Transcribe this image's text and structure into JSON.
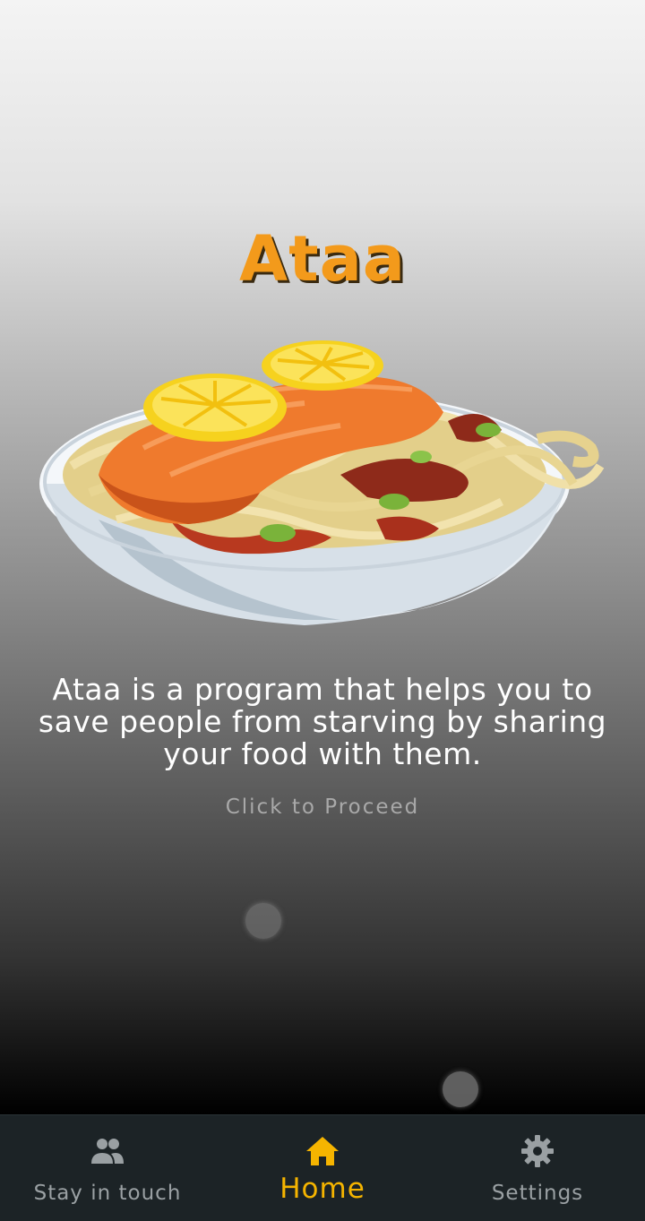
{
  "app": {
    "title": "Ataa",
    "description": "Ataa is a program that helps you to save people from starving by sharing your food with them.",
    "proceed_label": "Click to Proceed"
  },
  "colors": {
    "title": "#f39a1b",
    "nav_active": "#f5b400",
    "nav_inactive": "#9aa0a3",
    "nav_background": "#1c2326"
  },
  "bottom_nav": {
    "items": [
      {
        "label": "Stay in touch",
        "icon": "people-icon",
        "active": false
      },
      {
        "label": "Home",
        "icon": "home-icon",
        "active": true
      },
      {
        "label": "Settings",
        "icon": "gear-icon",
        "active": false
      }
    ]
  }
}
